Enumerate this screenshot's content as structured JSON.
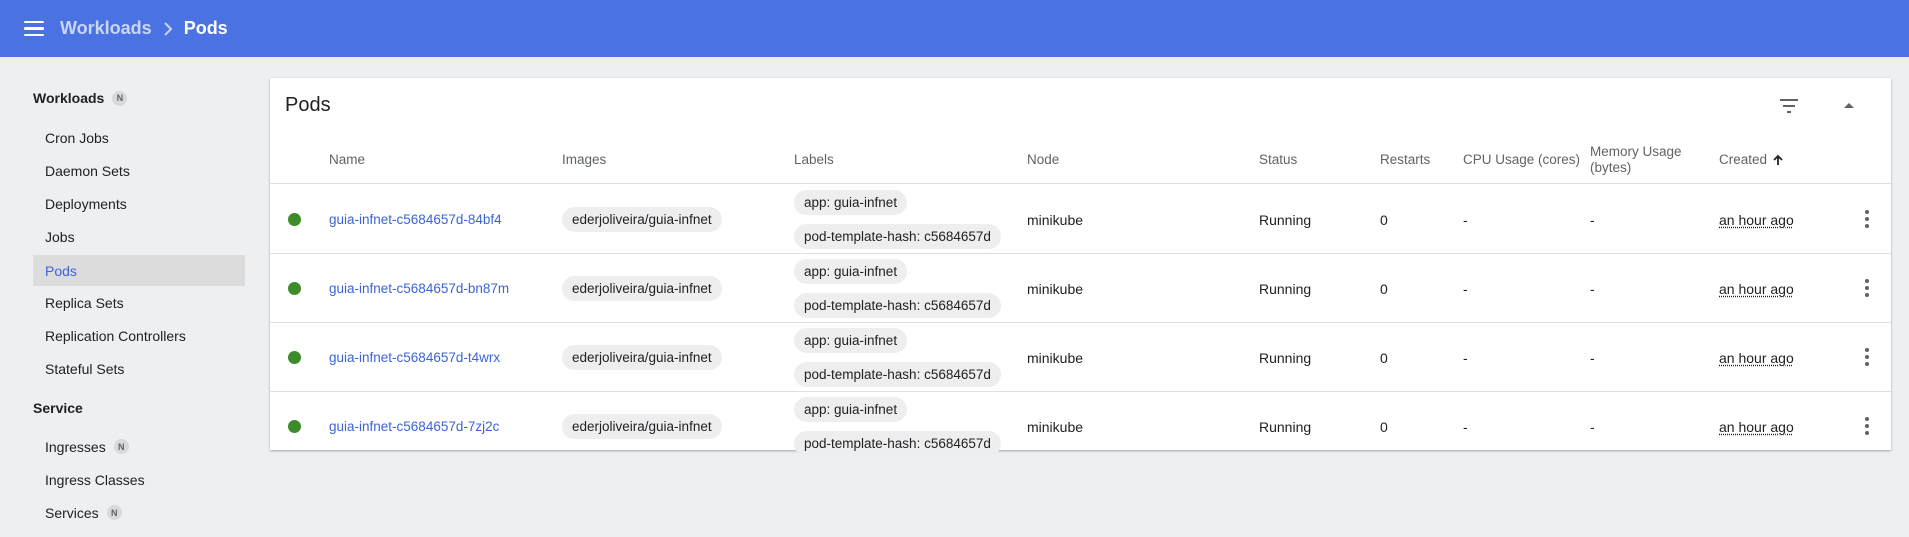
{
  "header": {
    "breadcrumb_parent": "Workloads",
    "breadcrumb_current": "Pods",
    "menu_icon": "menu-icon",
    "separator_icon": "chevron-right-icon"
  },
  "sidebar": {
    "sections": [
      {
        "title": "Workloads",
        "badge": "N",
        "items": [
          "Cron Jobs",
          "Daemon Sets",
          "Deployments",
          "Jobs",
          "Pods",
          "Replica Sets",
          "Replication Controllers",
          "Stateful Sets"
        ],
        "active": "Pods"
      },
      {
        "title": "Service",
        "items": [
          "Ingresses",
          "Ingress Classes",
          "Services"
        ],
        "item_badges": {
          "Ingresses": "N",
          "Services": "N"
        }
      }
    ]
  },
  "card": {
    "title": "Pods",
    "filter_icon": "filter-icon",
    "collapse_icon": "chevron-up-icon"
  },
  "table": {
    "columns": [
      "Name",
      "Images",
      "Labels",
      "Node",
      "Status",
      "Restarts",
      "CPU Usage (cores)",
      "Memory Usage (bytes)",
      "Created"
    ],
    "sort_icon": "arrow-up-icon",
    "rows": [
      {
        "name": "guia-infnet-c5684657d-84bf4",
        "image": "ederjoliveira/guia-infnet",
        "labels": [
          "app: guia-infnet",
          "pod-template-hash: c5684657d"
        ],
        "node": "minikube",
        "status": "Running",
        "restarts": "0",
        "cpu": "-",
        "memory": "-",
        "created": "an hour ago"
      },
      {
        "name": "guia-infnet-c5684657d-bn87m",
        "image": "ederjoliveira/guia-infnet",
        "labels": [
          "app: guia-infnet",
          "pod-template-hash: c5684657d"
        ],
        "node": "minikube",
        "status": "Running",
        "restarts": "0",
        "cpu": "-",
        "memory": "-",
        "created": "an hour ago"
      },
      {
        "name": "guia-infnet-c5684657d-t4wrx",
        "image": "ederjoliveira/guia-infnet",
        "labels": [
          "app: guia-infnet",
          "pod-template-hash: c5684657d"
        ],
        "node": "minikube",
        "status": "Running",
        "restarts": "0",
        "cpu": "-",
        "memory": "-",
        "created": "an hour ago"
      },
      {
        "name": "guia-infnet-c5684657d-7zj2c",
        "image": "ederjoliveira/guia-infnet",
        "labels": [
          "app: guia-infnet",
          "pod-template-hash: c5684657d"
        ],
        "node": "minikube",
        "status": "Running",
        "restarts": "0",
        "cpu": "-",
        "memory": "-",
        "created": "an hour ago"
      }
    ]
  },
  "colors": {
    "topbar": "#4a72e2",
    "link": "#3c64d4",
    "status_ok": "#3e8b2c"
  }
}
